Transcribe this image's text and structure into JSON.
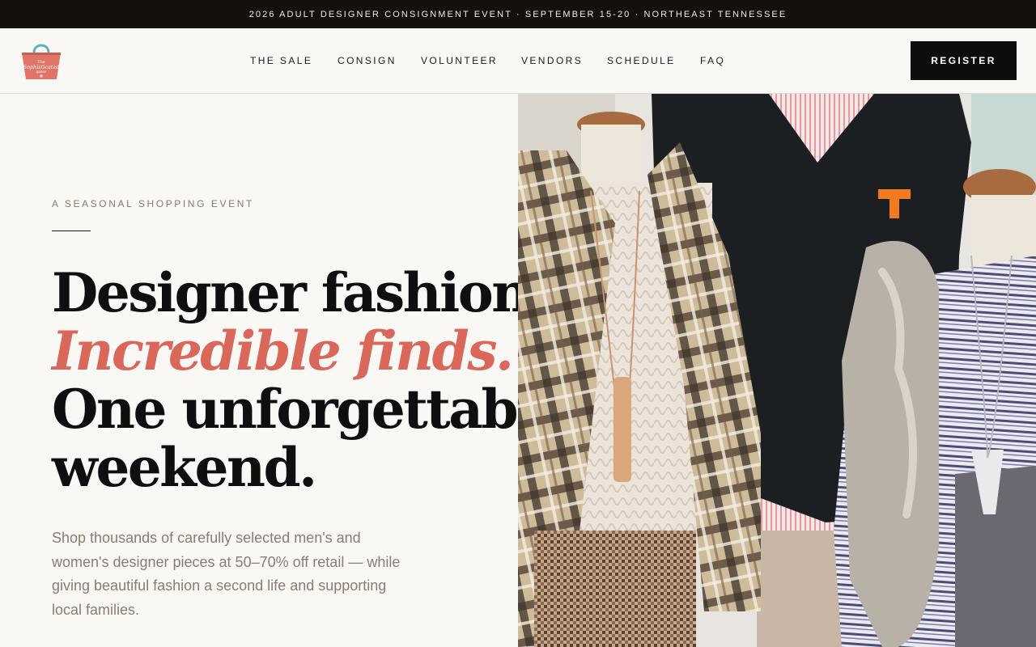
{
  "announcement": "2026 ADULT DESIGNER CONSIGNMENT EVENT · SEPTEMBER 15-20 · NORTHEAST TENNESSEE",
  "logo": {
    "icon": "tote-bag-logo",
    "line1": "The",
    "line2": "Sophisticated",
    "line3": "goose"
  },
  "nav": {
    "items": [
      "THE SALE",
      "CONSIGN",
      "VOLUNTEER",
      "VENDORS",
      "SCHEDULE",
      "FAQ"
    ],
    "register_label": "REGISTER"
  },
  "hero": {
    "eyebrow": "A SEASONAL SHOPPING EVENT",
    "headline_line1": "Designer fashion.",
    "headline_line2": "Incredible finds.",
    "headline_line3": "One unforgettable",
    "headline_line4": "weekend.",
    "description": "Shop thousands of carefully selected men's and women's designer pieces at 50–70% off retail — while giving beautiful fashion a second life and supporting local families.",
    "image_badge": "T"
  },
  "colors": {
    "accent": "#d9685a",
    "dark": "#15100d",
    "muted": "#877a70",
    "background": "#faf8f5"
  }
}
